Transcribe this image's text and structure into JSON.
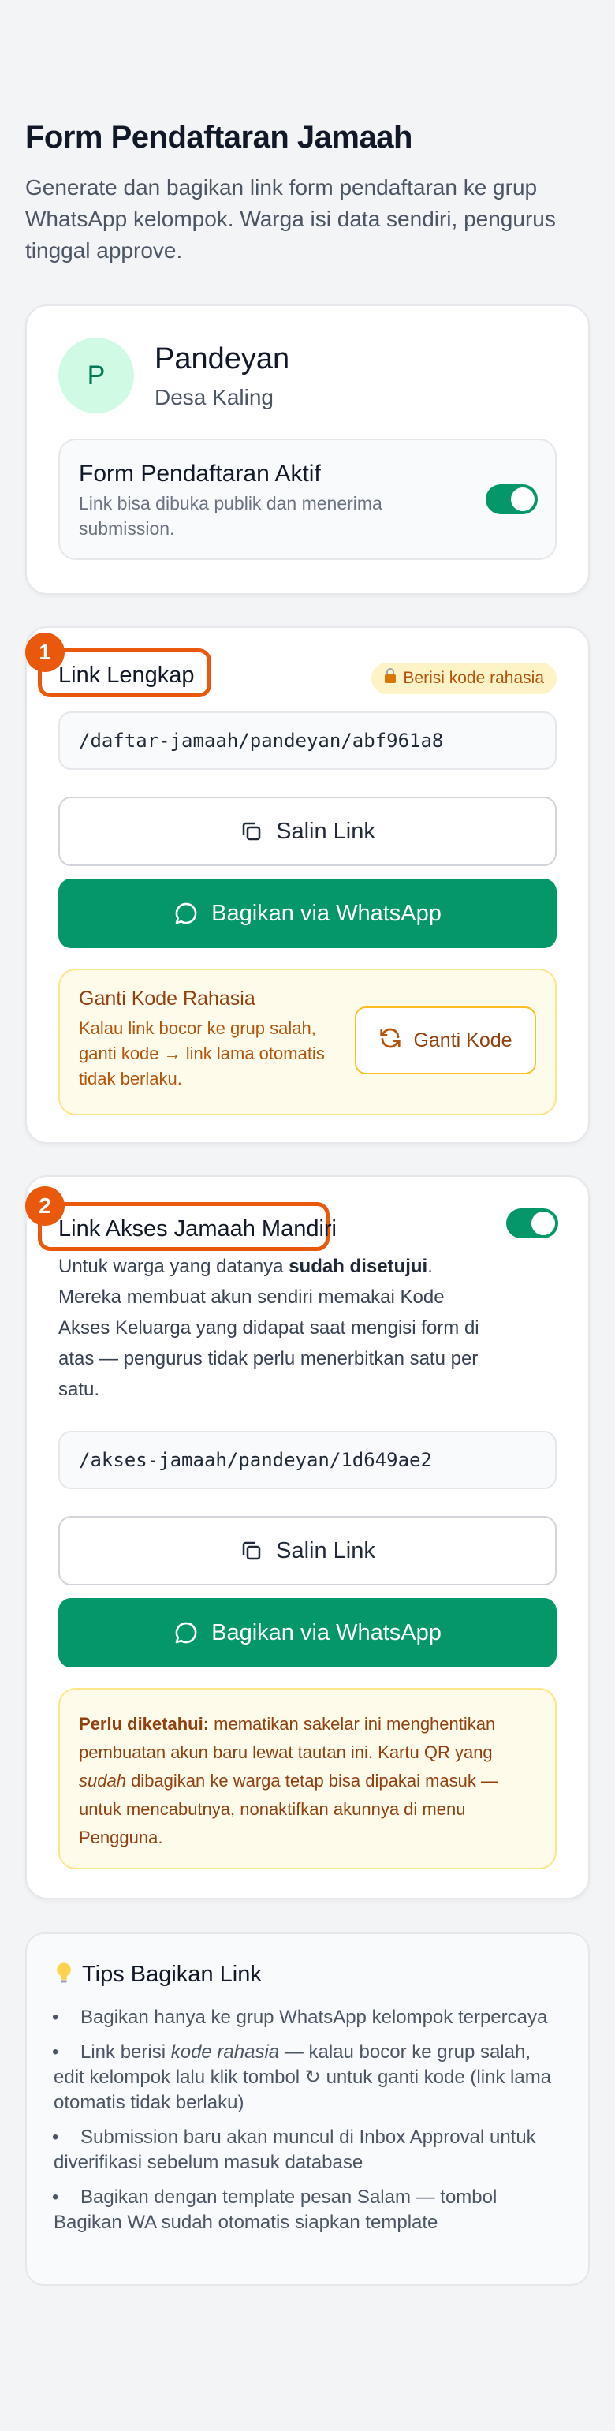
{
  "page": {
    "title": "Form Pendaftaran Jamaah",
    "description": "Generate dan bagikan link form pendaftaran ke grup WhatsApp kelompok. Warga isi data sendiri, pengurus tinggal approve."
  },
  "group_card": {
    "avatar_letter": "P",
    "name": "Pandeyan",
    "subtitle": "Desa Kaling",
    "form_active": {
      "title": "Form Pendaftaran Aktif",
      "description": "Link bisa dibuka publik dan menerima submission.",
      "enabled": true
    }
  },
  "full_link": {
    "step": "1",
    "label": "Link Lengkap",
    "badge": "Berisi kode rahasia",
    "url": "/daftar-jamaah/pandeyan/abf961a8",
    "copy_label": "Salin Link",
    "share_label": "Bagikan via WhatsApp",
    "rotate": {
      "title": "Ganti Kode Rahasia",
      "description": "Kalau link bocor ke grup salah, ganti kode → link lama otomatis tidak berlaku.",
      "button_label": "Ganti Kode"
    }
  },
  "access_link": {
    "step": "2",
    "label": "Link Akses Jamaah Mandiri",
    "enabled": true,
    "desc_before": "Untuk warga yang datanya ",
    "desc_bold": "sudah disetujui",
    "desc_after": ". Mereka membuat akun sendiri memakai Kode Akses Keluarga yang didapat saat mengisi form di atas — pengurus tidak perlu menerbitkan satu per satu.",
    "url": "/akses-jamaah/pandeyan/1d649ae2",
    "copy_label": "Salin Link",
    "share_label": "Bagikan via WhatsApp",
    "note": {
      "bold": "Perlu diketahui:",
      "part1": " mematikan sakelar ini menghentikan pembuatan akun baru lewat tautan ini. Kartu QR yang ",
      "italic": "sudah",
      "part2": " dibagikan ke warga tetap bisa dipakai masuk — untuk mencabutnya, nonaktifkan akunnya di menu Pengguna."
    }
  },
  "tips": {
    "title": "Tips Bagikan Link",
    "items": [
      "Bagikan hanya ke grup WhatsApp kelompok terpercaya",
      {
        "before": "Link berisi ",
        "italic": "kode rahasia",
        "after": " — kalau bocor ke grup salah, edit kelompok lalu klik tombol ↻ untuk ganti kode (link lama otomatis tidak berlaku)"
      },
      "Submission baru akan muncul di Inbox Approval untuk diverifikasi sebelum masuk database",
      "Bagikan dengan template pesan Salam — tombol Bagikan WA sudah otomatis siapkan template"
    ]
  },
  "colors": {
    "primary_green": "#059669",
    "accent_orange": "#ea580c",
    "warning_bg": "#fffbeb",
    "warning_text": "#92400e"
  },
  "icons": [
    "copy-icon",
    "whatsapp-icon",
    "refresh-icon",
    "lock-icon",
    "lightbulb-icon"
  ]
}
